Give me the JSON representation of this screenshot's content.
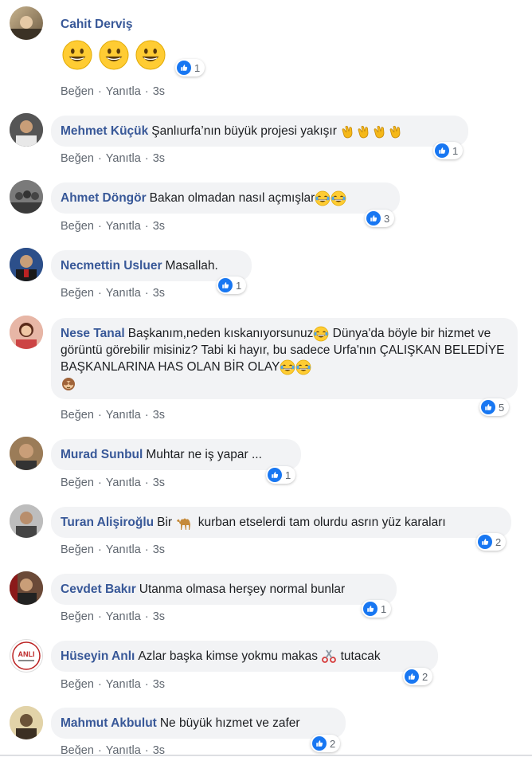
{
  "comments": [
    {
      "author": "Cahit Derviş",
      "text": "",
      "likes": "1",
      "action_like": "Beğen",
      "action_reply": "Yanıtla",
      "time": "3s"
    },
    {
      "author": "Mehmet Küçük",
      "text": "Şanlıurfa’nın büyük projesi yakışır",
      "likes": "1",
      "action_like": "Beğen",
      "action_reply": "Yanıtla",
      "time": "3s"
    },
    {
      "author": "Ahmet Döngör",
      "text": "Bakan olmadan nasıl açmışlar",
      "likes": "3",
      "action_like": "Beğen",
      "action_reply": "Yanıtla",
      "time": "3s"
    },
    {
      "author": "Necmettin Usluer",
      "text": "Masallah.",
      "likes": "1",
      "action_like": "Beğen",
      "action_reply": "Yanıtla",
      "time": "3s"
    },
    {
      "author": "Nese Tanal",
      "text1": "Başkanım,neden kıskanıyorsunuz",
      "text2": "Dünya'da böyle bir hizmet ve görüntü görebilir misiniz? Tabi ki hayır, bu sadece Urfa'nın ÇALIŞKAN BELEDİYE BAŞKANLARINA HAS OLAN BİR OLAY",
      "likes": "5",
      "action_like": "Beğen",
      "action_reply": "Yanıtla",
      "time": "3s"
    },
    {
      "author": "Murad Sunbul",
      "text": "Muhtar ne iş yapar ...",
      "likes": "1",
      "action_like": "Beğen",
      "action_reply": "Yanıtla",
      "time": "3s"
    },
    {
      "author": "Turan Alişiroğlu",
      "text1": "Bir",
      "text2": "kurban etselerdi tam olurdu asrın yüz karaları",
      "likes": "2",
      "action_like": "Beğen",
      "action_reply": "Yanıtla",
      "time": "3s"
    },
    {
      "author": "Cevdet Bakır",
      "text": "Utanma olmasa herşey normal bunlar",
      "likes": "1",
      "action_like": "Beğen",
      "action_reply": "Yanıtla",
      "time": "3s"
    },
    {
      "author": "Hüseyin Anlı",
      "text1": "Azlar başka kimse yokmu makas",
      "text2": "tutacak",
      "likes": "2",
      "action_like": "Beğen",
      "action_reply": "Yanıtla",
      "time": "3s",
      "avatar_text": "ANLI"
    },
    {
      "author": "Mahmut Akbulut",
      "text": "Ne büyük hızmet ve zafer",
      "likes": "2",
      "action_like": "Beğen",
      "action_reply": "Yanıtla",
      "time": "3s"
    }
  ],
  "icons": {
    "like": "like-icon",
    "grin": "grinning-face-emoji",
    "clap": "clapping-hands-emoji",
    "laugh": "tears-of-joy-emoji",
    "rofl": "rolling-laughing-emoji",
    "monkey": "see-no-evil-monkey-emoji",
    "camel": "camel-emoji",
    "scissors": "scissors-emoji"
  },
  "colors": {
    "author": "#385898",
    "bubble": "#f2f3f5",
    "like": "#1877f2",
    "meta": "#606770"
  }
}
